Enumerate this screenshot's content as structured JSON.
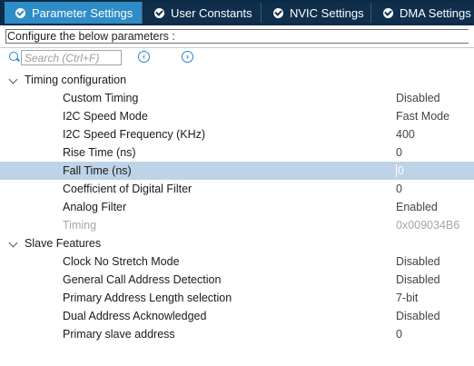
{
  "tabs": [
    {
      "label": "Parameter Settings",
      "active": true
    },
    {
      "label": "User Constants",
      "active": false
    },
    {
      "label": "NVIC Settings",
      "active": false
    },
    {
      "label": "DMA Settings",
      "active": false
    }
  ],
  "header": {
    "configure_text": "Configure the below parameters :"
  },
  "search": {
    "placeholder": "Search (Ctrl+F)",
    "value": ""
  },
  "timing": {
    "title": "Timing configuration",
    "rows": [
      {
        "name": "Custom Timing",
        "value": "Disabled"
      },
      {
        "name": "I2C Speed Mode",
        "value": "Fast Mode"
      },
      {
        "name": "I2C Speed Frequency (KHz)",
        "value": "400"
      },
      {
        "name": "Rise Time (ns)",
        "value": "0"
      },
      {
        "name": "Fall Time (ns)",
        "value": "0"
      },
      {
        "name": "Coefficient of Digital Filter",
        "value": "0"
      },
      {
        "name": "Analog Filter",
        "value": "Enabled"
      },
      {
        "name": "Timing",
        "value": "0x009034B6"
      }
    ]
  },
  "slave": {
    "title": "Slave Features",
    "rows": [
      {
        "name": "Clock No Stretch Mode",
        "value": "Disabled"
      },
      {
        "name": "General Call Address Detection",
        "value": "Disabled"
      },
      {
        "name": "Primary Address Length selection",
        "value": "7-bit"
      },
      {
        "name": "Dual Address Acknowledged",
        "value": "Disabled"
      },
      {
        "name": "Primary slave address",
        "value": "0"
      }
    ]
  },
  "icons": {
    "search": "search-icon",
    "prev": "circle-arrow-left-icon",
    "next": "circle-arrow-right-icon",
    "expand": "chevron-down-icon",
    "tab_check": "check-circle-icon"
  },
  "colors": {
    "tab_bar": "#0d2b45",
    "active_tab": "#2e8cc6",
    "selected_row": "#bed3e8",
    "accent": "#2d7fc1"
  }
}
